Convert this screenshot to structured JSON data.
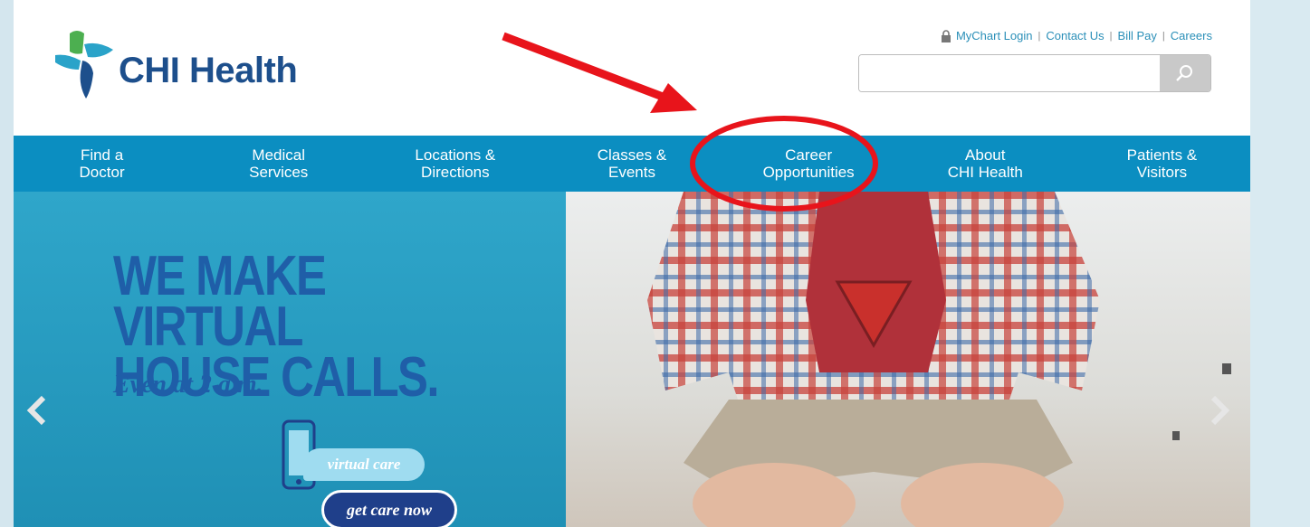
{
  "brand": {
    "name": "CHI Health",
    "text_color": "#1d4f8c",
    "logo_colors": [
      "#4caf50",
      "#2aa3c9",
      "#1d4f8c"
    ]
  },
  "utility_nav": {
    "lock_icon": "lock-icon",
    "links": [
      "MyChart Login",
      "Contact Us",
      "Bill Pay",
      "Careers"
    ],
    "separator": "|"
  },
  "search": {
    "value": "",
    "placeholder": "",
    "button_icon": "search-icon"
  },
  "main_nav": {
    "color": "#0b8ec1",
    "items": [
      "Find a\nDoctor",
      "Medical\nServices",
      "Locations &\nDirections",
      "Classes &\nEvents",
      "Career\nOpportunities",
      "About\nCHI Health",
      "Patients &\nVisitors"
    ]
  },
  "hero": {
    "headline": "WE MAKE VIRTUAL\nHOUSE CALLS.",
    "subhead": "Even at 2 a.m.",
    "pill_label": "virtual care",
    "cta_label": "get care now",
    "prev_icon": "chevron-left-icon",
    "next_icon": "chevron-right-icon"
  },
  "annotation": {
    "color": "#e8141b",
    "highlighted_item": "Career Opportunities"
  }
}
